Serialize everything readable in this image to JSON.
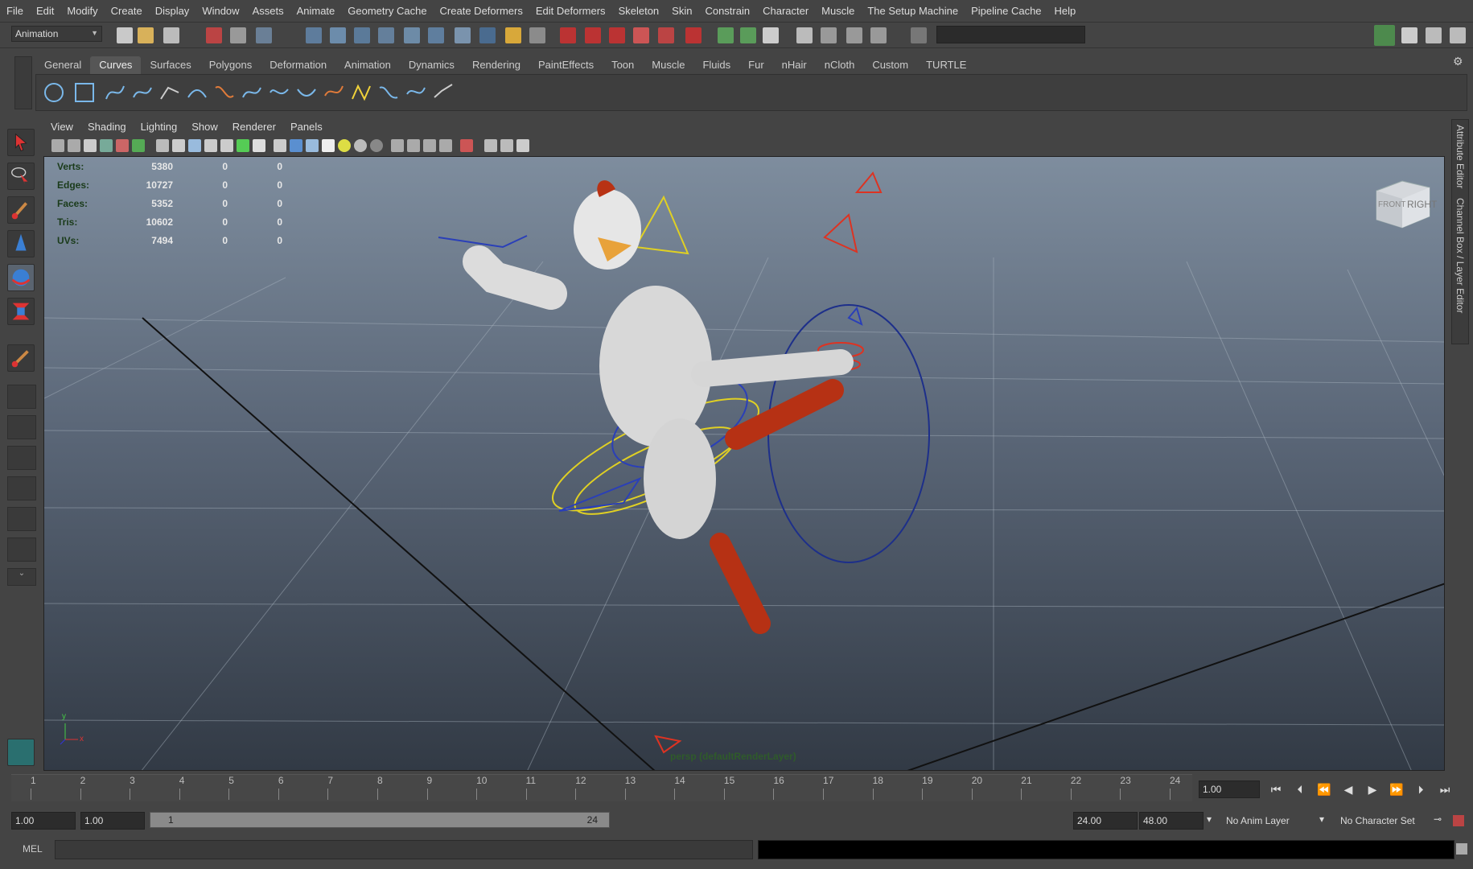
{
  "menubar": [
    "File",
    "Edit",
    "Modify",
    "Create",
    "Display",
    "Window",
    "Assets",
    "Animate",
    "Geometry Cache",
    "Create Deformers",
    "Edit Deformers",
    "Skeleton",
    "Skin",
    "Constrain",
    "Character",
    "Muscle",
    "The Setup Machine",
    "Pipeline Cache",
    "Help"
  ],
  "statusline": {
    "mode": "Animation"
  },
  "shelf": {
    "tabs": [
      "General",
      "Curves",
      "Surfaces",
      "Polygons",
      "Deformation",
      "Animation",
      "Dynamics",
      "Rendering",
      "PaintEffects",
      "Toon",
      "Muscle",
      "Fluids",
      "Fur",
      "nHair",
      "nCloth",
      "Custom",
      "TURTLE"
    ],
    "active": "Curves"
  },
  "panel_menu": [
    "View",
    "Shading",
    "Lighting",
    "Show",
    "Renderer",
    "Panels"
  ],
  "hud": [
    {
      "label": "Verts:",
      "value": "5380",
      "sel": "0",
      "comp": "0"
    },
    {
      "label": "Edges:",
      "value": "10727",
      "sel": "0",
      "comp": "0"
    },
    {
      "label": "Faces:",
      "value": "5352",
      "sel": "0",
      "comp": "0"
    },
    {
      "label": "Tris:",
      "value": "10602",
      "sel": "0",
      "comp": "0"
    },
    {
      "label": "UVs:",
      "value": "7494",
      "sel": "0",
      "comp": "0"
    }
  ],
  "viewcube": {
    "front": "FRONT",
    "right": "RIGHT"
  },
  "axis": {
    "y": "y",
    "x": "x"
  },
  "camera_label": "persp (defaultRenderLayer)",
  "right_tabs": {
    "attribute_editor": "Attribute Editor",
    "channel_box": "Channel Box / Layer Editor"
  },
  "timeline": {
    "frames": [
      "1",
      "2",
      "3",
      "4",
      "5",
      "6",
      "7",
      "8",
      "9",
      "10",
      "11",
      "12",
      "13",
      "14",
      "15",
      "16",
      "17",
      "18",
      "19",
      "20",
      "21",
      "22",
      "23",
      "24"
    ],
    "current_frame": "1.00"
  },
  "range": {
    "start": "1.00",
    "playback_start": "1.00",
    "slider_start": "1",
    "slider_end": "24",
    "playback_end": "24.00",
    "end": "48.00",
    "anim_layer": "No Anim Layer",
    "character_set": "No Character Set"
  },
  "command_line": {
    "label": "MEL"
  }
}
